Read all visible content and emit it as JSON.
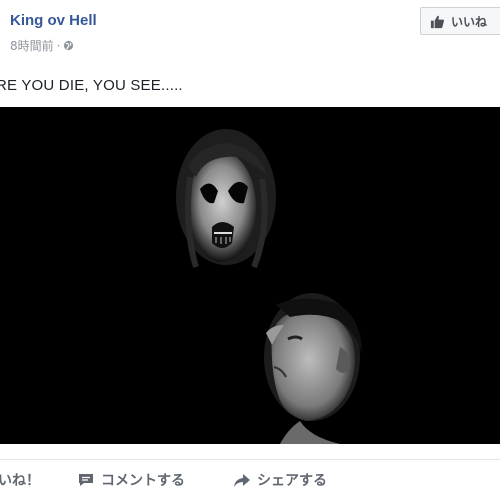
{
  "post": {
    "page_name": "King ov Hell",
    "timestamp": "8時間前",
    "separator": "·",
    "like_page_label": "いいね",
    "text": "RE YOU DIE, YOU SEE.....",
    "actions": {
      "like": "いね！",
      "comment": "コメントする",
      "share": "シェアする"
    }
  },
  "colors": {
    "link_blue": "#365899",
    "meta_gray": "#90949c",
    "action_gray": "#606770"
  },
  "icons": {
    "globe": "globe-icon",
    "thumbs_up": "thumbs-up-icon",
    "comment": "comment-icon",
    "share": "share-arrow-icon"
  }
}
